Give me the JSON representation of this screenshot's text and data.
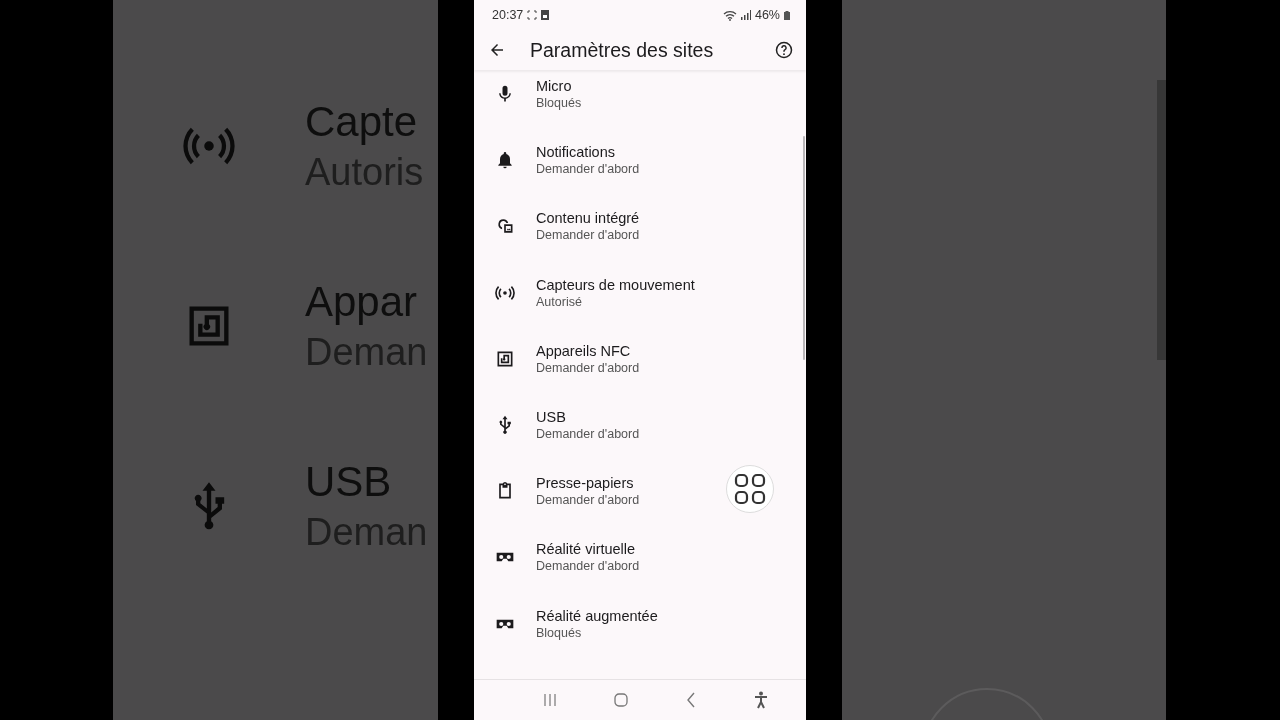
{
  "backdrop_left": {
    "rows": [
      {
        "title": "Capte",
        "subtitle": "Autoris"
      },
      {
        "title": "Appar",
        "subtitle": "Deman"
      },
      {
        "title": "USB",
        "subtitle": "Deman"
      }
    ]
  },
  "status_bar": {
    "time": "20:37",
    "battery": "46%"
  },
  "header": {
    "title": "Paramètres des sites"
  },
  "settings": [
    {
      "title": "Micro",
      "subtitle": "Bloqués"
    },
    {
      "title": "Notifications",
      "subtitle": "Demander d'abord"
    },
    {
      "title": "Contenu intégré",
      "subtitle": "Demander d'abord"
    },
    {
      "title": "Capteurs de mouvement",
      "subtitle": "Autorisé"
    },
    {
      "title": "Appareils NFC",
      "subtitle": "Demander d'abord"
    },
    {
      "title": "USB",
      "subtitle": "Demander d'abord"
    },
    {
      "title": "Presse-papiers",
      "subtitle": "Demander d'abord"
    },
    {
      "title": "Réalité virtuelle",
      "subtitle": "Demander d'abord"
    },
    {
      "title": "Réalité augmentée",
      "subtitle": "Bloqués"
    }
  ]
}
